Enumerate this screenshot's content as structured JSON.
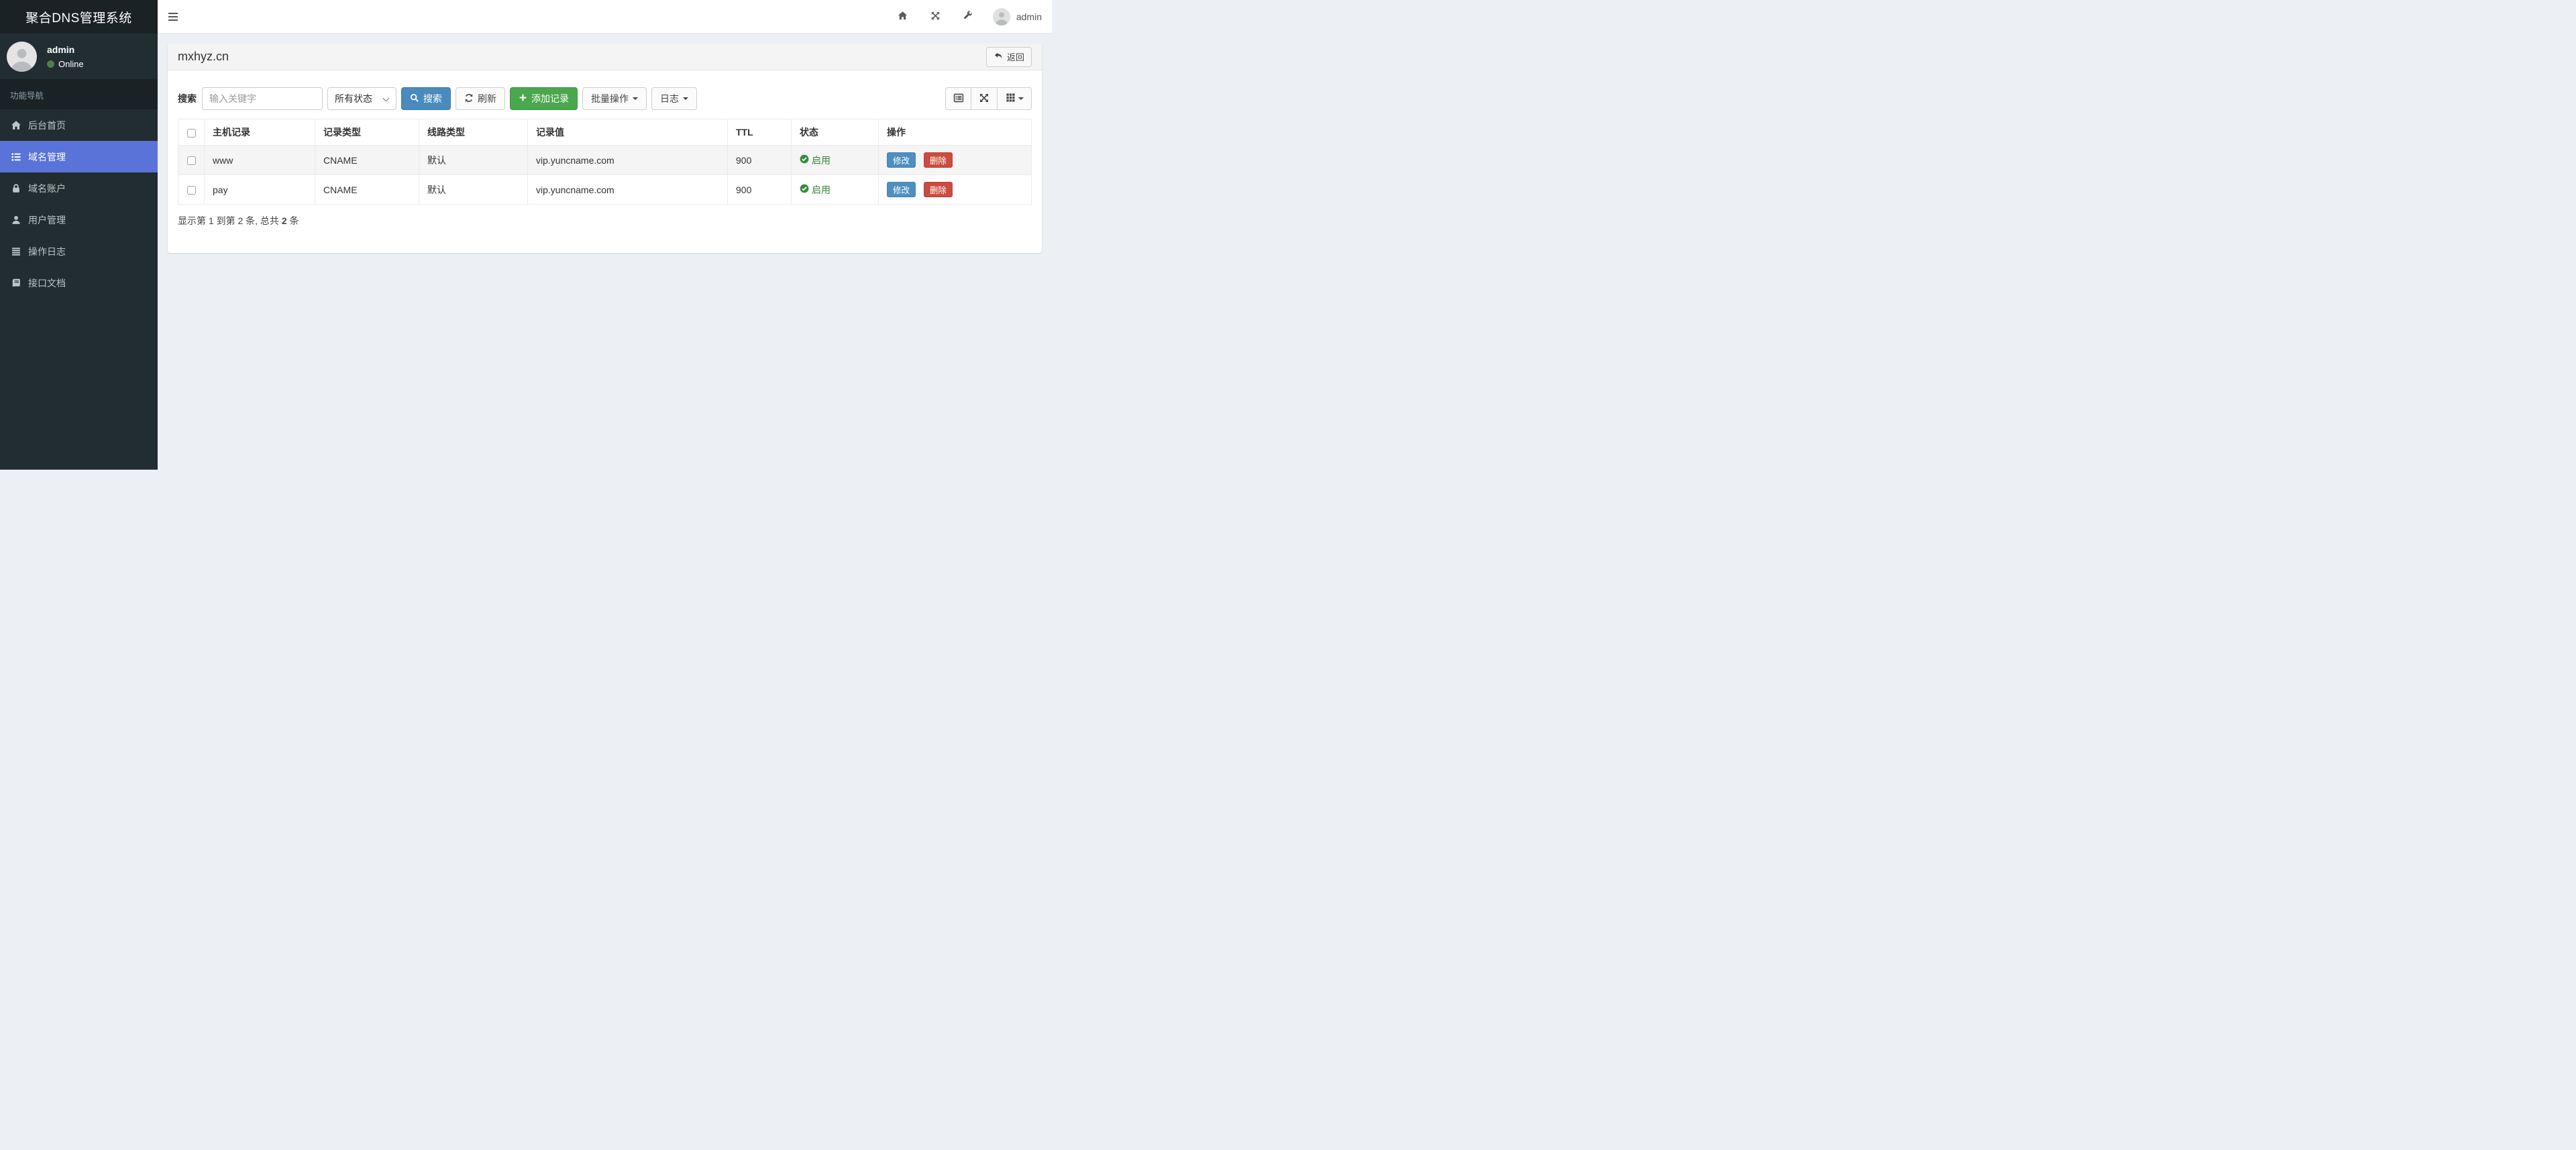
{
  "app": {
    "title": "聚合DNS管理系统"
  },
  "navbar": {
    "username": "admin"
  },
  "sidebar": {
    "user": {
      "name": "admin",
      "status": "Online"
    },
    "section_label": "功能导航",
    "items": [
      {
        "label": "后台首页",
        "icon": "home-icon",
        "active": false
      },
      {
        "label": "域名管理",
        "icon": "list-icon",
        "active": true
      },
      {
        "label": "域名账户",
        "icon": "lock-icon",
        "active": false
      },
      {
        "label": "用户管理",
        "icon": "user-icon",
        "active": false
      },
      {
        "label": "操作日志",
        "icon": "log-icon",
        "active": false
      },
      {
        "label": "接口文档",
        "icon": "book-icon",
        "active": false
      }
    ]
  },
  "panel": {
    "title": "mxhyz.cn",
    "back_button": "返回"
  },
  "toolbar": {
    "search_label": "搜索",
    "keyword_placeholder": "输入关键字",
    "status_filter": "所有状态",
    "search_button": "搜索",
    "refresh_button": "刷新",
    "add_button": "添加记录",
    "batch_button": "批量操作",
    "log_button": "日志"
  },
  "table": {
    "columns": [
      "主机记录",
      "记录类型",
      "线路类型",
      "记录值",
      "TTL",
      "状态",
      "操作"
    ],
    "rows": [
      {
        "host": "www",
        "type": "CNAME",
        "line": "默认",
        "value": "vip.yuncname.com",
        "ttl": "900",
        "status": "启用"
      },
      {
        "host": "pay",
        "type": "CNAME",
        "line": "默认",
        "value": "vip.yuncname.com",
        "ttl": "900",
        "status": "启用"
      }
    ],
    "actions": {
      "edit": "修改",
      "delete": "删除"
    },
    "summary": {
      "prefix": "显示第 1 到第 2 条, 总共 ",
      "total": "2",
      "suffix": " 条"
    }
  },
  "colors": {
    "sidebar_bg": "#222d32",
    "sidebar_dark": "#1a2226",
    "active_item": "#5a73d8",
    "page_bg": "#ecf0f5",
    "primary_blue": "#4a8bbd",
    "success_green": "#4aa74e",
    "danger_red": "#cb4b3f",
    "status_green": "#35883a",
    "online_dot": "#4e7e4a"
  }
}
